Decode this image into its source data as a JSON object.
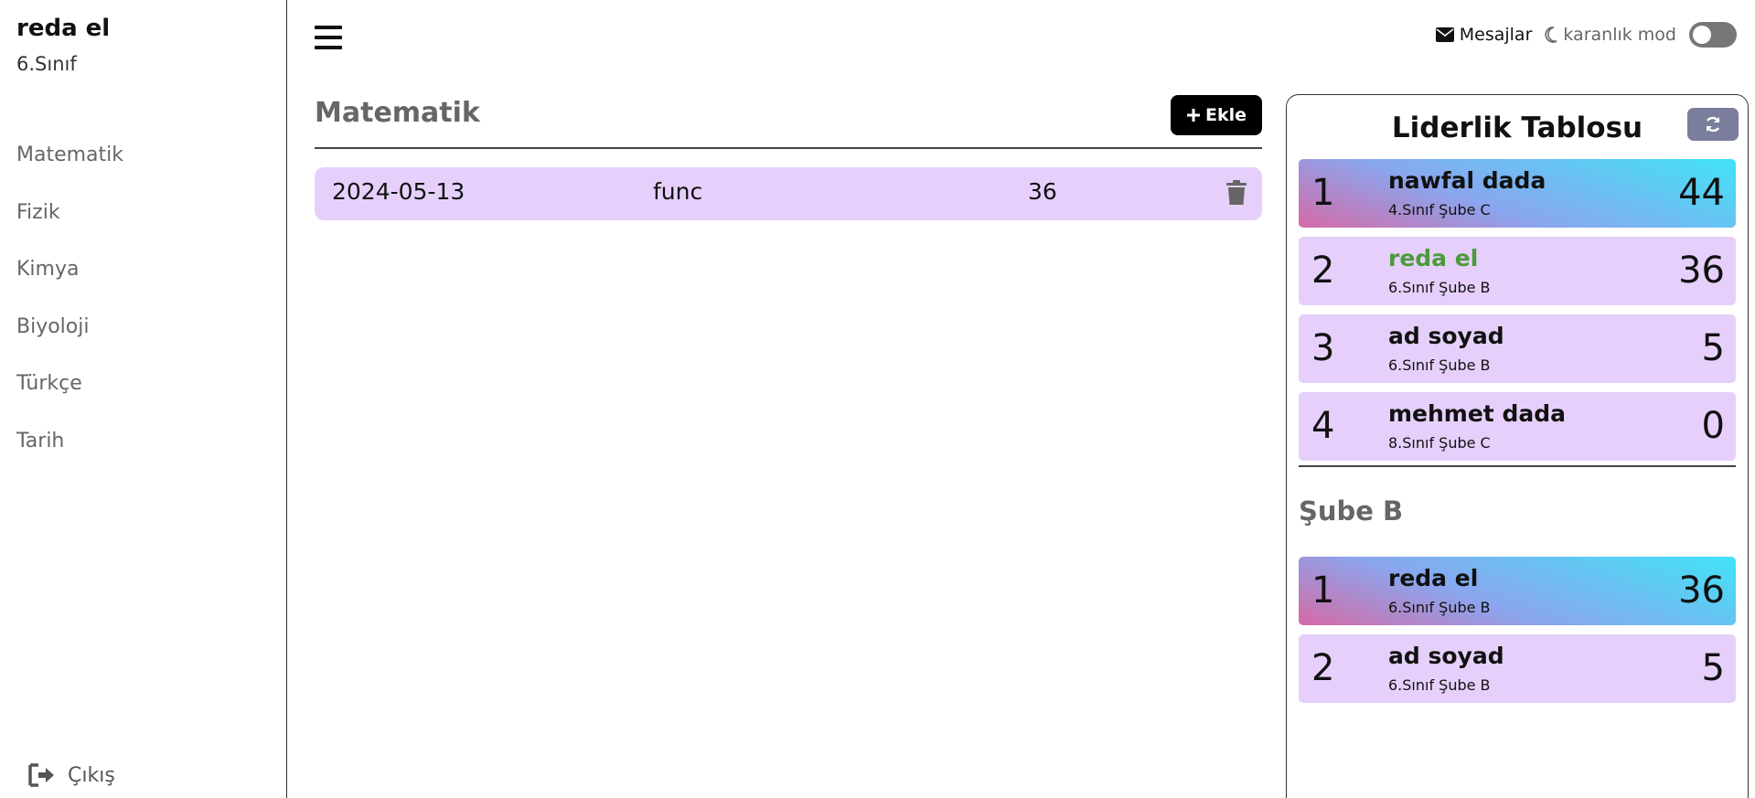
{
  "user": {
    "name": "reda el",
    "class": "6.Sınıf"
  },
  "sidebar": {
    "items": [
      {
        "label": "Matematik"
      },
      {
        "label": "Fizik"
      },
      {
        "label": "Kimya"
      },
      {
        "label": "Biyoloji"
      },
      {
        "label": "Türkçe"
      },
      {
        "label": "Tarih"
      }
    ],
    "logout_label": "Çıkış"
  },
  "topbar": {
    "messages_label": "Mesajlar",
    "dark_mode_label": "karanlık mod",
    "dark_mode_on": false
  },
  "subject": {
    "title": "Matematik",
    "add_label": "Ekle",
    "records": [
      {
        "date": "2024-05-13",
        "topic": "func",
        "score": "36"
      }
    ]
  },
  "leaderboard": {
    "title": "Liderlik Tablosu",
    "overall": [
      {
        "rank": "1",
        "name": "nawfal dada",
        "class": "4.Sınıf Şube C",
        "score": "44"
      },
      {
        "rank": "2",
        "name": "reda el",
        "class": "6.Sınıf Şube B",
        "score": "36"
      },
      {
        "rank": "3",
        "name": "ad soyad",
        "class": "6.Sınıf Şube B",
        "score": "5"
      },
      {
        "rank": "4",
        "name": "mehmet dada",
        "class": "8.Sınıf Şube C",
        "score": "0"
      }
    ],
    "branch_title": "Şube B",
    "branch": [
      {
        "rank": "1",
        "name": "reda el",
        "class": "6.Sınıf Şube B",
        "score": "36"
      },
      {
        "rank": "2",
        "name": "ad soyad",
        "class": "6.Sınıf Şube B",
        "score": "5"
      }
    ]
  },
  "colors": {
    "row_bg": "#e6d0fb",
    "highlight_name": "#4c9a3b",
    "refresh_bg": "#7a7d9c"
  }
}
